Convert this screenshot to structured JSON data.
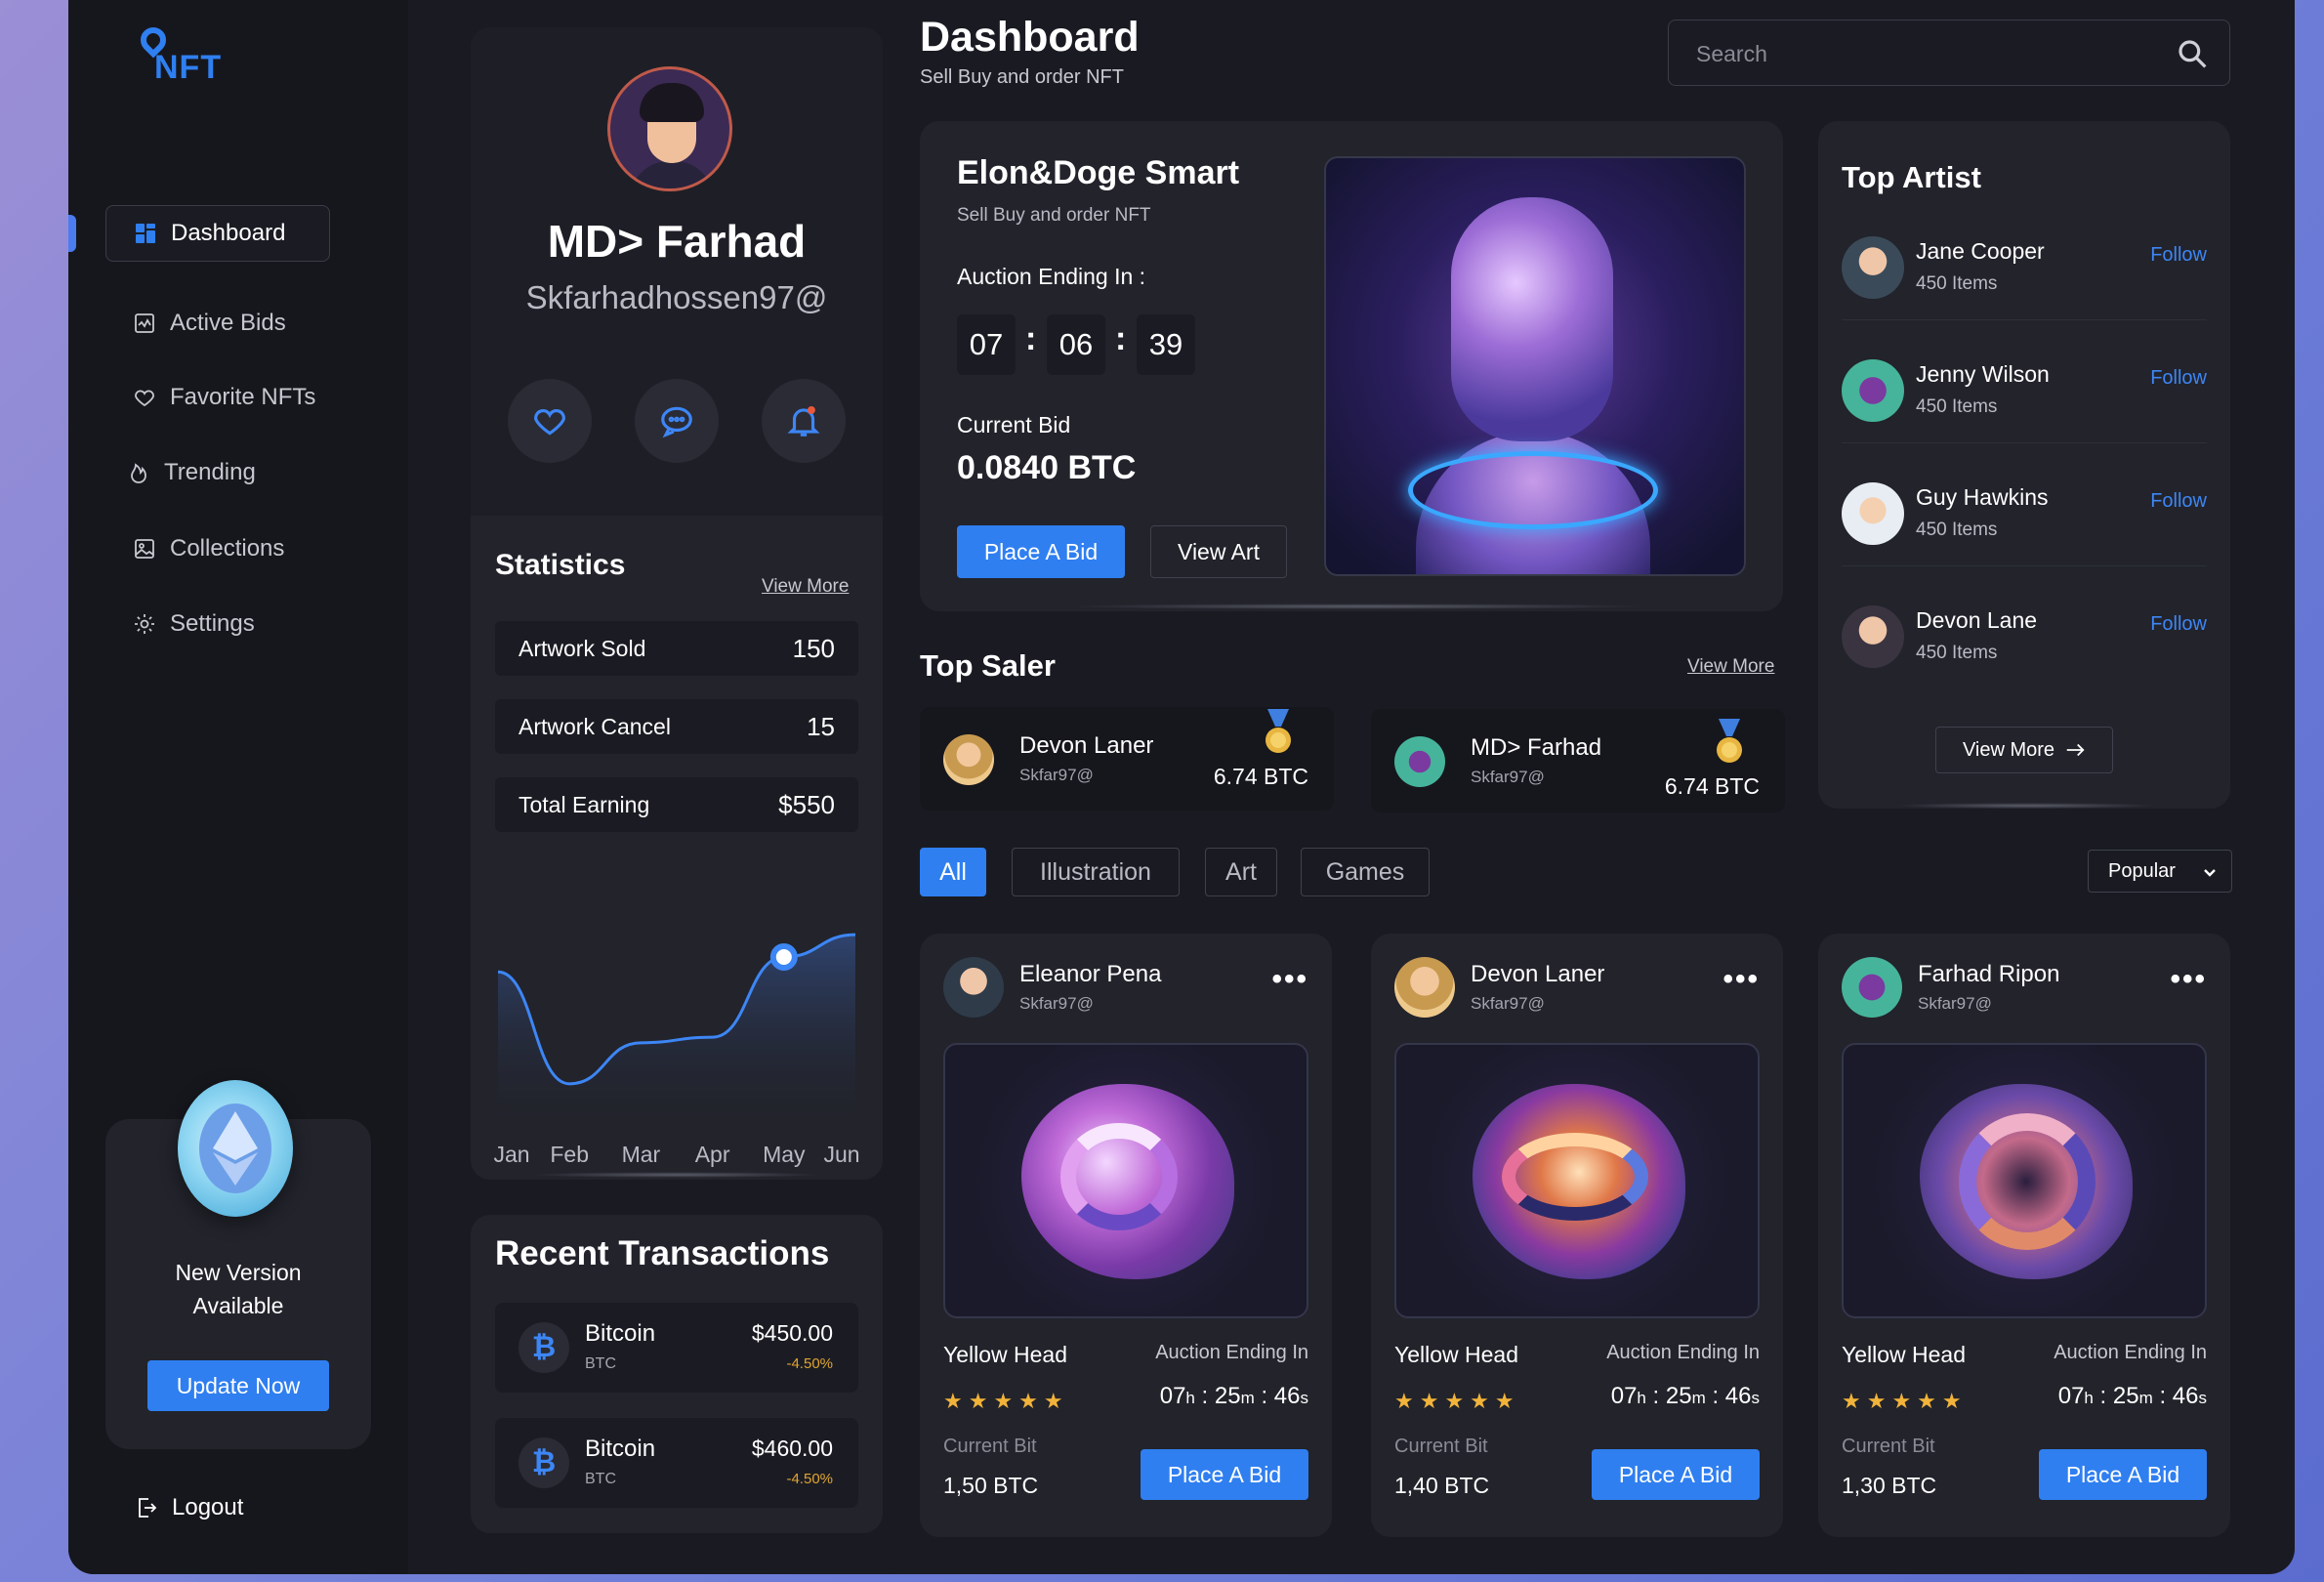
{
  "logo": {
    "text": "NFT"
  },
  "sidebar": {
    "items": [
      {
        "label": "Dashboard",
        "icon": "dashboard-icon",
        "active": true
      },
      {
        "label": "Active Bids",
        "icon": "chart-icon"
      },
      {
        "label": "Favorite NFTs",
        "icon": "heart-icon"
      },
      {
        "label": "Trending",
        "icon": "flame-icon"
      },
      {
        "label": "Collections",
        "icon": "image-icon"
      },
      {
        "label": "Settings",
        "icon": "gear-icon"
      }
    ],
    "promo": {
      "text_line1": "New Version",
      "text_line2": "Available",
      "button": "Update Now"
    },
    "logout": "Logout"
  },
  "profile": {
    "name": "MD> Farhad",
    "email": "Skfarhadhossen97@",
    "actions": [
      "heart-icon",
      "chat-icon",
      "bell-icon"
    ]
  },
  "statistics": {
    "title": "Statistics",
    "view_more": "View More",
    "rows": [
      {
        "label": "Artwork Sold",
        "value": "150"
      },
      {
        "label": "Artwork Cancel",
        "value": "15"
      },
      {
        "label": "Total Earning",
        "value": "$550"
      }
    ]
  },
  "chart_data": {
    "type": "area",
    "categories": [
      "Jan",
      "Feb",
      "Mar",
      "Apr",
      "May",
      "Jun"
    ],
    "values": [
      80,
      20,
      42,
      45,
      88,
      100
    ],
    "highlight_index": 4,
    "ylim": [
      0,
      110
    ],
    "grid": false
  },
  "transactions": {
    "title": "Recent Transactions",
    "items": [
      {
        "name": "Bitcoin",
        "symbol": "BTC",
        "amount": "$450.00",
        "change": "-4.50%"
      },
      {
        "name": "Bitcoin",
        "symbol": "BTC",
        "amount": "$460.00",
        "change": "-4.50%"
      }
    ]
  },
  "header": {
    "title": "Dashboard",
    "subtitle": "Sell Buy and order NFT",
    "search_placeholder": "Search"
  },
  "feature": {
    "title": "Elon&Doge Smart",
    "subtitle": "Sell Buy and order NFT",
    "auction_label": "Auction Ending In :",
    "timer": [
      "07",
      "06",
      "39"
    ],
    "current_bid_label": "Current Bid",
    "current_bid": "0.0840 BTC",
    "place_bid": "Place A Bid",
    "view_art": "View Art"
  },
  "top_saler": {
    "title": "Top Saler",
    "view_more": "View More",
    "items": [
      {
        "name": "Devon Laner",
        "email": "Skfar97@",
        "btc": "6.74 BTC"
      },
      {
        "name": "MD> Farhad",
        "email": "Skfar97@",
        "btc": "6.74 BTC"
      }
    ]
  },
  "filters": {
    "chips": [
      "All",
      "Illustration",
      "Art",
      "Games"
    ],
    "active": "All",
    "sort": "Popular"
  },
  "cards": [
    {
      "owner": "Eleanor Pena",
      "email": "Skfar97@",
      "title": "Yellow Head",
      "auction_label": "Auction Ending In",
      "time_h": "07",
      "time_m": "25",
      "time_s": "46",
      "rating": 5,
      "bid_label": "Current Bit",
      "bid": "1,50 BTC",
      "button": "Place A Bid"
    },
    {
      "owner": "Devon Laner",
      "email": "Skfar97@",
      "title": "Yellow Head",
      "auction_label": "Auction Ending In",
      "time_h": "07",
      "time_m": "25",
      "time_s": "46",
      "rating": 5,
      "bid_label": "Current Bit",
      "bid": "1,40 BTC",
      "button": "Place A Bid"
    },
    {
      "owner": "Farhad Ripon",
      "email": "Skfar97@",
      "title": "Yellow Head",
      "auction_label": "Auction Ending In",
      "time_h": "07",
      "time_m": "25",
      "time_s": "46",
      "rating": 5,
      "bid_label": "Current Bit",
      "bid": "1,30 BTC",
      "button": "Place A Bid"
    }
  ],
  "top_artist": {
    "title": "Top Artist",
    "items": [
      {
        "name": "Jane Cooper",
        "items": "450 Items",
        "follow": "Follow"
      },
      {
        "name": "Jenny Wilson",
        "items": "450 Items",
        "follow": "Follow"
      },
      {
        "name": "Guy Hawkins",
        "items": "450 Items",
        "follow": "Follow"
      },
      {
        "name": "Devon Lane",
        "items": "450 Items",
        "follow": "Follow"
      }
    ],
    "view_more": "View More"
  },
  "colors": {
    "accent": "#2f7ff0",
    "background": "#1a1b22",
    "panel": "#22232b",
    "star": "#f2b33a"
  }
}
